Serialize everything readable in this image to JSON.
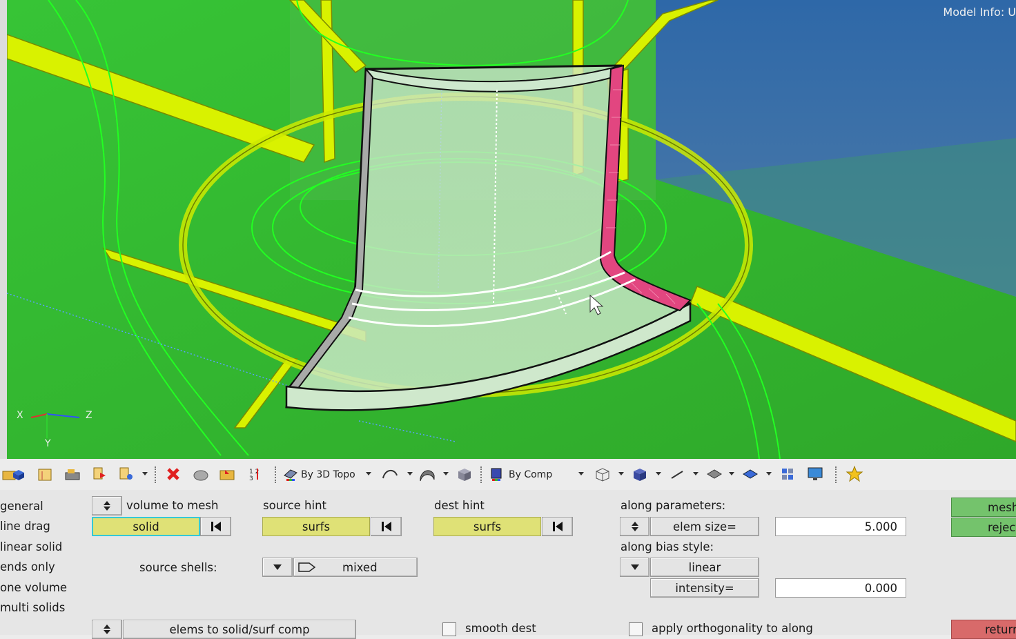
{
  "viewport": {
    "model_info": "Model Info: U",
    "axis_labels": {
      "x": "X",
      "y": "Y",
      "z": "Z"
    }
  },
  "toolbar": {
    "icons": [
      "folder-icon",
      "blue-box-icon",
      "grid-folder-icon",
      "tool-box-icon",
      "red-flag-icon",
      "hierarchy-icon",
      "delete-icon",
      "collectors-icon",
      "folder-arrow-icon",
      "numbering-icon",
      "topology-icon",
      "curve-icon",
      "surface-icon",
      "solid-cube-icon",
      "comp-color-icon",
      "wireframe-cube-icon",
      "shaded-cube-icon",
      "line-icon",
      "plane-icon",
      "blue-plane-icon",
      "card-icon",
      "monitor-icon",
      "star-icon"
    ],
    "topo_mode": "By 3D Topo",
    "color_mode": "By Comp"
  },
  "panel": {
    "sidebar": [
      "general",
      "line drag",
      "linear solid",
      "ends only",
      "one volume",
      "multi solids"
    ],
    "volume_to_mesh_label": "volume to mesh",
    "solid_btn": "solid",
    "source_hint_label": "source hint",
    "source_hint_btn": "surfs",
    "dest_hint_label": "dest hint",
    "dest_hint_btn": "surfs",
    "source_shells_label": "source shells:",
    "source_shells_value": "mixed",
    "along_parameters_label": "along parameters:",
    "elem_size_btn": "elem size=",
    "elem_size_value": "5.000",
    "along_bias_label": "along bias style:",
    "bias_style_value": "linear",
    "intensity_btn": "intensity=",
    "intensity_value": "0.000",
    "mesh_btn": "mesh",
    "reject_btn": "reject",
    "return_btn": "return",
    "elems_to_comp": "elems to solid/surf comp",
    "smooth_dest_label": "smooth dest",
    "apply_orth_label": "apply orthogonality to along"
  }
}
